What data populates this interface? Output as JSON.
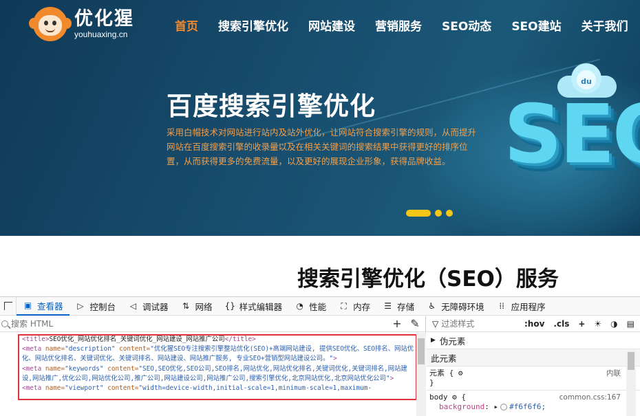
{
  "site": {
    "logo_title": "优化猩",
    "logo_domain": "youhuaxing.cn",
    "nav": [
      {
        "label": "首页",
        "active": true
      },
      {
        "label": "搜索引擎优化"
      },
      {
        "label": "网站建设"
      },
      {
        "label": "营销服务"
      },
      {
        "label": "SEO动态"
      },
      {
        "label": "SEO建站"
      },
      {
        "label": "关于我们"
      }
    ],
    "hero_title": "百度搜索引擎优化",
    "hero_desc": "采用白帽技术对网站进行站内及站外优化，让网站符合搜索引擎的规则，从而提升网站在百度搜索引擎的收录量以及在相关关键词的搜索结果中获得更好的排序位置，从而获得更多的免费流量，以及更好的展现企业形象，获得品牌收益。",
    "hero_art_text": "SEO",
    "hero_art_badge": "du",
    "section_title": "搜索引擎优化（SEO）服务"
  },
  "devtools": {
    "tabs": [
      {
        "label": "查看器",
        "icon": "inspector-icon",
        "glyph": "▣",
        "active": true
      },
      {
        "label": "控制台",
        "icon": "console-icon",
        "glyph": "▷"
      },
      {
        "label": "调试器",
        "icon": "debugger-icon",
        "glyph": "◁"
      },
      {
        "label": "网络",
        "icon": "network-icon",
        "glyph": "⇅"
      },
      {
        "label": "样式编辑器",
        "icon": "style-editor-icon",
        "glyph": "{}"
      },
      {
        "label": "性能",
        "icon": "performance-icon",
        "glyph": "◔"
      },
      {
        "label": "内存",
        "icon": "memory-icon",
        "glyph": "⛶"
      },
      {
        "label": "存储",
        "icon": "storage-icon",
        "glyph": "☰"
      },
      {
        "label": "无障碍环境",
        "icon": "accessibility-icon",
        "glyph": "♿"
      },
      {
        "label": "应用程序",
        "icon": "application-icon",
        "glyph": "⁞⁞"
      }
    ],
    "search_placeholder": "搜索 HTML",
    "html": {
      "title_open": "<title>",
      "title_text": "SEO优化_网站优化排名_关键词优化_网站建设_网站推广公司",
      "title_close": "</title>",
      "meta_desc_open": "<meta ",
      "meta_desc_attr": "name=",
      "meta_desc_name": "\"description\"",
      "meta_desc_content_attr": " content=",
      "meta_desc_content": "\"优化猩SEO专注搜索引擎整站优化(SEO)+高端网站建设, 提供SEO优化、SEO排名、网站优化、网站优化排名、关键词优化、关键词排名、网站建设、网站推广服务, 专业SEO+营销型网站建设公司。\"",
      "meta_desc_close": ">",
      "meta_kw_open": "<meta ",
      "meta_kw_attr": "name=",
      "meta_kw_name": "\"keywords\"",
      "meta_kw_content_attr": " content=",
      "meta_kw_content": "\"SEO,SEO优化,SEO公司,SEO排名,网站优化,网站优化排名,关键词优化,关键词排名,网站建设,网站推广,优化公司,网站优化公司,推广公司,网站建设公司,网站推广公司,搜索引擎优化,北京网站优化,北京网站优化公司\"",
      "meta_kw_close": ">",
      "meta_vp_open": "<meta ",
      "meta_vp_attr": "name=",
      "meta_vp_name": "\"viewport\"",
      "meta_vp_content_attr": " content=",
      "meta_vp_content": "\"width=device-width,initial-scale=1,minimum-scale=1,maximum-"
    },
    "rules": {
      "filter_placeholder": "过滤样式",
      "hov": ":hov",
      "cls": ".cls",
      "pseudo_section": "伪元素",
      "this_element": "此元素",
      "element_selector": "元素 {",
      "element_close": "}",
      "inline_label": "内联",
      "body_selector": "body",
      "body_open": "{",
      "body_source": "common.css:167",
      "background_prop": "background",
      "background_value": "#f6f6f6;"
    }
  }
}
